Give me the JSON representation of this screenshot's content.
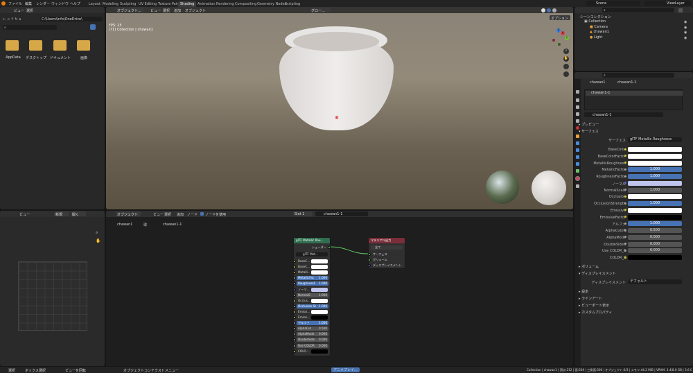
{
  "menus": [
    "ファイル",
    "編集",
    "レンダー",
    "ウィンドウ",
    "ヘルプ"
  ],
  "workspaces": [
    "Layout",
    "Modeling",
    "Sculpting",
    "UV Editing",
    "Texture Paint",
    "Shading",
    "Animation",
    "Rendering",
    "Compositing",
    "Geometry Nodes",
    "Scripting"
  ],
  "active_workspace": "Shading",
  "scene": {
    "name": "Scene",
    "view_layer": "ViewLayer"
  },
  "file_browser": {
    "menus": [
      "ビュー",
      "選択"
    ],
    "path": "C:\\Users\\info\\OneDrive\\",
    "folders": [
      {
        "name": "AppData"
      },
      {
        "name": "デスクトップ"
      },
      {
        "name": "ドキュメント"
      },
      {
        "name": "画像"
      }
    ]
  },
  "viewport": {
    "mode": "オブジェクト...",
    "menus": [
      "ビュー",
      "選択",
      "追加",
      "オブジェクト"
    ],
    "orientation": "グロー...",
    "options": "オプション",
    "fps": "FPS: 25",
    "collection": "(71) Collection | chawan1",
    "axis": {
      "x": "X",
      "y": "Y",
      "z": "Z"
    }
  },
  "image_editor": {
    "view": "ビュー",
    "new": "新規",
    "open": "開く"
  },
  "node_editor": {
    "mode": "オブジェクト",
    "menus": [
      "ビュー",
      "選択",
      "追加",
      "ノード"
    ],
    "use_nodes": "ノードを使用",
    "slot": "Slot 1",
    "material": "chawan1-1",
    "breadcrumb": [
      "chawan1",
      "球",
      "chawan1-1"
    ],
    "gltf_node": {
      "title": "glTF Metallic Rou...",
      "shader_out": "シェーダー",
      "group": "glTF Met...",
      "rows": [
        {
          "label": "BaseC...",
          "kind": "white",
          "value": ""
        },
        {
          "label": "BaseC...",
          "kind": "white",
          "value": ""
        },
        {
          "label": "Metalli...",
          "kind": "white",
          "value": ""
        },
        {
          "label": "MetallicFac",
          "kind": "blue",
          "value": "1.000"
        },
        {
          "label": "RoughnessF",
          "kind": "blue",
          "value": "1.000"
        },
        {
          "label": "ノーマ...",
          "kind": "lav",
          "value": ""
        },
        {
          "label": "NormalS",
          "kind": "grey",
          "value": "1.000"
        },
        {
          "label": "Occlus...",
          "kind": "white",
          "value": ""
        },
        {
          "label": "Occlusion St",
          "kind": "blue",
          "value": "1.000"
        },
        {
          "label": "Emissi...",
          "kind": "white",
          "value": ""
        },
        {
          "label": "Emissi...",
          "kind": "black",
          "value": ""
        },
        {
          "label": "アルファ",
          "kind": "blue",
          "value": "1.000"
        },
        {
          "label": "AlphaCut",
          "kind": "grey",
          "value": "0.500"
        },
        {
          "label": "AlphaMode",
          "kind": "grey",
          "value": "0.000"
        },
        {
          "label": "DoubleSide",
          "kind": "grey",
          "value": "0.000"
        },
        {
          "label": "Use COLOR",
          "kind": "grey",
          "value": "0.000"
        },
        {
          "label": "COLO...",
          "kind": "black",
          "value": ""
        }
      ]
    },
    "output_node": {
      "title": "マテリアル出力",
      "target": "全て",
      "inputs": [
        "サーフェス",
        "ボリューム",
        "ディスプレイスメント"
      ]
    }
  },
  "outliner": {
    "title": "シーンコレクション",
    "items": [
      {
        "name": "Collection",
        "level": 1
      },
      {
        "name": "Camera",
        "level": 2
      },
      {
        "name": "chawan1",
        "level": 2
      },
      {
        "name": "Light",
        "level": 2
      }
    ]
  },
  "properties": {
    "object": "chawan1",
    "material": "chawan1-1",
    "slot": "chawan1-1",
    "mat_field": "chawan1-1",
    "sections": {
      "preview": "プレビュー",
      "surface": "サーフェス",
      "volume": "ボリューム",
      "displacement": "ディスプレイスメント",
      "settings": "設定",
      "lineart": "ラインアート",
      "viewport_display": "ビューポート表示",
      "custom_props": "カスタムプロパティ"
    },
    "surface_label": "サーフェス",
    "surface_value": "glTF Metallic Roughness",
    "rows": [
      {
        "label": "BaseColor",
        "kind": "white",
        "value": ""
      },
      {
        "label": "BaseColorFactor",
        "kind": "white",
        "value": ""
      },
      {
        "label": "MetallicRoughness",
        "kind": "white",
        "value": ""
      },
      {
        "label": "MetallicFactor",
        "kind": "blue",
        "value": "1.000"
      },
      {
        "label": "RoughnessFactor",
        "kind": "blue",
        "value": "1.000"
      },
      {
        "label": "ノーマル",
        "kind": "lav",
        "value": ""
      },
      {
        "label": "NormalScale",
        "kind": "grey",
        "value": "1.000"
      },
      {
        "label": "Occlusion",
        "kind": "white",
        "value": ""
      },
      {
        "label": "OcclusionStrength",
        "kind": "blue",
        "value": "1.000"
      },
      {
        "label": "Emissive",
        "kind": "white",
        "value": ""
      },
      {
        "label": "EmissiveFactor",
        "kind": "black",
        "value": ""
      },
      {
        "label": "アルファ",
        "kind": "blue",
        "value": "1.000"
      },
      {
        "label": "AlphaCutoff",
        "kind": "grey",
        "value": "0.500"
      },
      {
        "label": "AlphaMode",
        "kind": "grey",
        "value": "0.000"
      },
      {
        "label": "DoubleSided",
        "kind": "grey",
        "value": "0.000"
      },
      {
        "label": "Use COLOR_0",
        "kind": "grey",
        "value": "0.000"
      },
      {
        "label": "COLOR_0",
        "kind": "black",
        "value": ""
      }
    ],
    "disp_label": "ディスプレイスメント",
    "disp_value": "デフォルト"
  },
  "statusbar": {
    "left": [
      "選択",
      "ボックス選択",
      "ビューを回転",
      "オブジェクトコンテクストメニュー",
      "アニメプレイ..."
    ],
    "right": "Collection | chawan1 | 頂点:212 | 面:500 | 三角面:300 | オブジェクト:0/3 | メモリ:44.2 MiB | VRAM: 3.4/8.0 GB | 3.6.0"
  },
  "colors": {
    "accent": "#4772b3",
    "node_header_green": "#2f6e4f",
    "node_header_red": "#7a2e3a",
    "link": "#63c763"
  }
}
